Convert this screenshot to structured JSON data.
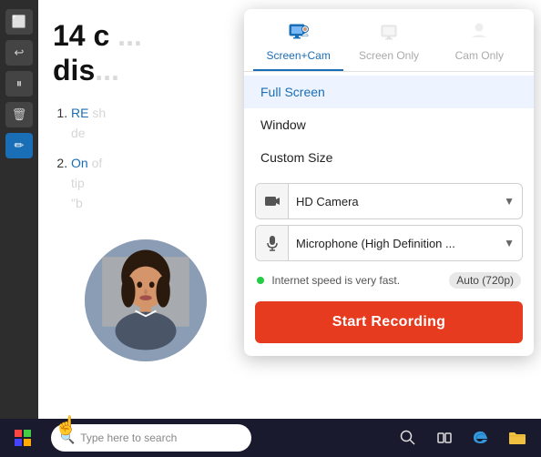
{
  "sidebar": {
    "buttons": [
      {
        "icon": "⬜",
        "label": "stop-btn",
        "active": false
      },
      {
        "icon": "↩",
        "label": "undo-btn",
        "active": false
      },
      {
        "icon": "⏸",
        "label": "pause-btn",
        "active": false
      },
      {
        "icon": "🗑",
        "label": "delete-btn",
        "active": false
      },
      {
        "icon": "✏",
        "label": "pen-btn",
        "active": true,
        "pen": true
      }
    ]
  },
  "content": {
    "title": "14 c",
    "title2": "dis",
    "list_item1_link": "RE",
    "list_item1_text1": "sh",
    "list_item1_text2": "de",
    "list_item2_link": "On",
    "list_item2_text1": "of",
    "list_item2_text2": "tip",
    "list_item2_text3": "\"b"
  },
  "popup": {
    "tabs": [
      {
        "id": "screen-cam",
        "label": "Screen+Cam",
        "icon": "🖥",
        "active": true
      },
      {
        "id": "screen-only",
        "label": "Screen Only",
        "icon": "🖥",
        "active": false
      },
      {
        "id": "cam-only",
        "label": "Cam Only",
        "icon": "👤",
        "active": false
      }
    ],
    "options": [
      {
        "label": "Full Screen",
        "selected": true
      },
      {
        "label": "Window",
        "selected": false
      },
      {
        "label": "Custom Size",
        "selected": false
      }
    ],
    "camera_label": "HD Camera",
    "mic_label": "Microphone (High Definition ...",
    "status_text": "Internet speed is very fast.",
    "quality_label": "Auto (720p)",
    "record_button": "Start Recording"
  },
  "taskbar": {
    "search_placeholder": "Type here to search",
    "windows_icon": "⊞"
  }
}
